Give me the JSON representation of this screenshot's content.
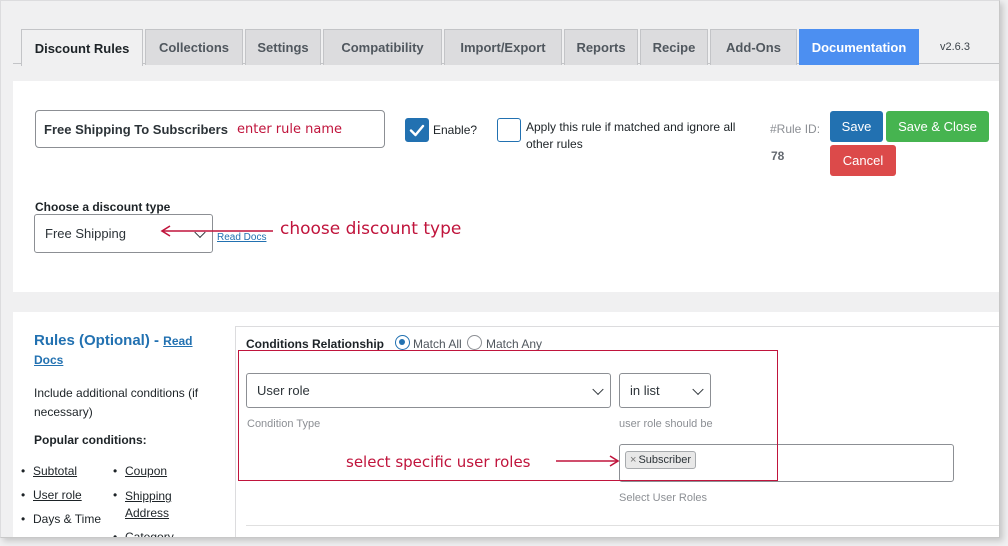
{
  "tabs": [
    {
      "label": "Discount Rules"
    },
    {
      "label": "Collections"
    },
    {
      "label": "Settings"
    },
    {
      "label": "Compatibility"
    },
    {
      "label": "Import/Export"
    },
    {
      "label": "Reports"
    },
    {
      "label": "Recipe"
    },
    {
      "label": "Add-Ons"
    },
    {
      "label": "Documentation"
    }
  ],
  "version": "v2.6.3",
  "rule": {
    "name_value": "Free Shipping To Subscribers",
    "enable_label": "Enable?",
    "enable_checked": true,
    "apply_label": "Apply this rule if matched and ignore all other rules",
    "rule_id_label": "#Rule ID:",
    "rule_id": "78",
    "save_label": "Save",
    "save_close_label": "Save & Close",
    "cancel_label": "Cancel"
  },
  "discount": {
    "heading": "Choose a discount type",
    "selected": "Free Shipping",
    "read_docs": "Read Docs"
  },
  "annotations": {
    "rule_name": "enter rule name",
    "discount_type": "choose discount type",
    "user_roles": "select specific user roles"
  },
  "sidebar": {
    "title": "Rules (Optional) - ",
    "read": "Read",
    "docs": "Docs",
    "description": "Include additional conditions (if necessary)",
    "popular": "Popular conditions:",
    "items": [
      "Subtotal",
      "Coupon",
      "User role",
      "Shipping Address",
      "Days & Time",
      "Category"
    ]
  },
  "conditions": {
    "relationship_label": "Conditions Relationship",
    "match_all": "Match All",
    "match_any": "Match Any",
    "condition_type_value": "User role",
    "condition_type_caption": "Condition Type",
    "operator_value": "in list",
    "operator_caption": "user role should be",
    "role_tag": "Subscriber",
    "roles_caption": "Select User Roles"
  },
  "colors": {
    "accent": "#2271b1",
    "save": "#2271b1",
    "save_close": "#46b450",
    "cancel": "#dc4a4a",
    "annotation": "#c0143c",
    "documentation_tab": "#4c8ff1"
  }
}
